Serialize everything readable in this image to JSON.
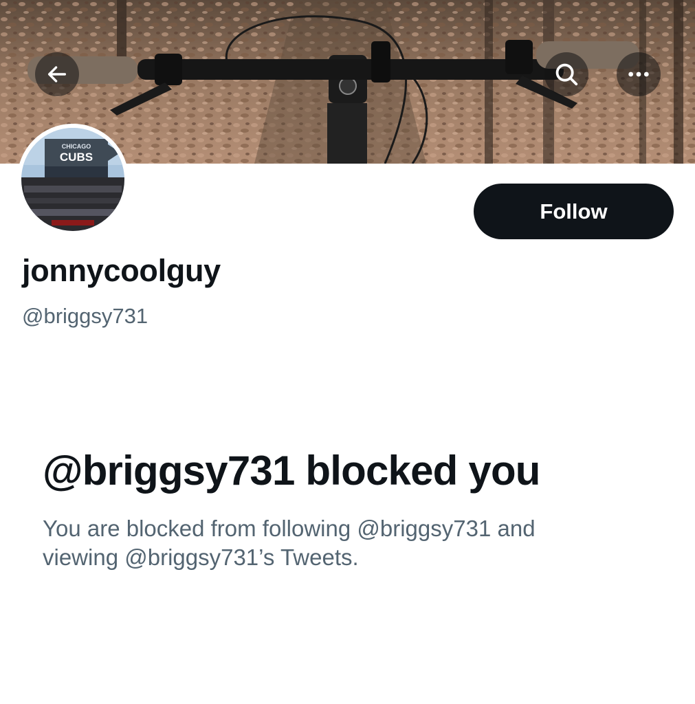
{
  "header": {
    "back_icon": "arrow-left-icon",
    "search_icon": "search-icon",
    "more_icon": "more-horizontal-icon"
  },
  "profile": {
    "display_name": "jonnycoolguy",
    "handle": "@briggsy731",
    "avatar_sign_top": "CHICAGO",
    "avatar_sign_main": "CUBS",
    "follow_label": "Follow"
  },
  "blocked": {
    "title": "@briggsy731 blocked you",
    "description_line1": "You are blocked from following @briggsy731 and",
    "description_line2": "viewing @briggsy731’s Tweets."
  },
  "colors": {
    "primary_text": "#0f1419",
    "secondary_text": "#536471",
    "button_bg": "#0f1419",
    "button_text": "#ffffff"
  }
}
